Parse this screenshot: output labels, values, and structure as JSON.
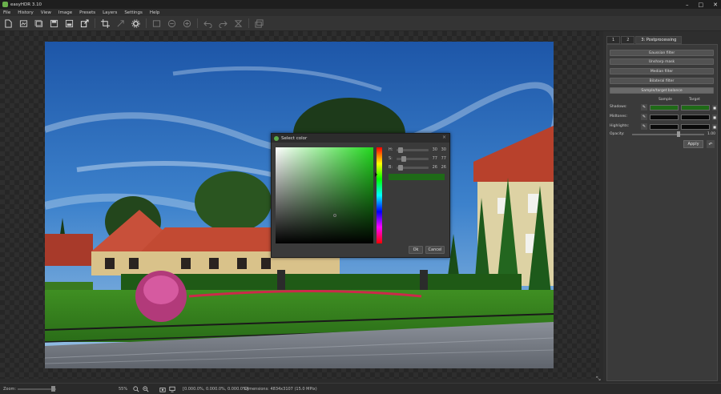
{
  "window": {
    "title": "easyHDR 3.10",
    "controls": [
      "–",
      "□",
      "✕"
    ]
  },
  "menu": [
    "File",
    "History",
    "View",
    "Image",
    "Presets",
    "Layers",
    "Settings",
    "Help"
  ],
  "toolbar": {
    "icons": [
      "new-icon",
      "open-icon",
      "open-multiple-icon",
      "save-icon",
      "save-as-icon",
      "export-icon",
      "crop-icon",
      "rotate-icon",
      "settings-icon",
      "batch-icon",
      "zoom-out-icon",
      "zoom-in-icon",
      "undo-icon",
      "redo-icon",
      "delete-icon",
      "layers-icon"
    ]
  },
  "color_dialog": {
    "title": "Select color",
    "close": "×",
    "rows": [
      {
        "label": "H:",
        "v1": "30",
        "v2": "30"
      },
      {
        "label": "S:",
        "v1": "77",
        "v2": "77"
      },
      {
        "label": "B:",
        "v1": "26",
        "v2": "26"
      }
    ],
    "preview_color": "#1f6a17",
    "ok": "Ok",
    "cancel": "Cancel"
  },
  "panel": {
    "tabs": [
      "1",
      "2",
      "3: Postprocessing"
    ],
    "filters": [
      "Gaussian filter",
      "Unsharp mask",
      "Median filter",
      "Bilateral filter",
      "Sample/target balance"
    ],
    "col_sample": "Sample",
    "col_target": "Target",
    "tones": [
      {
        "label": "Shadows:",
        "sample": "#1f6a17",
        "target": "#1f6a17"
      },
      {
        "label": "Midtones:",
        "sample": "#0a0a0a",
        "target": "#0a0a0a"
      },
      {
        "label": "Highlights:",
        "sample": "#0a0a0a",
        "target": "#0a0a0a"
      }
    ],
    "opacity_label": "Opacity:",
    "opacity_value": "1.00",
    "apply": "Apply"
  },
  "status": {
    "zoom_label": "Zoom:",
    "zoom_value": "55%",
    "pixel": "[0.000.0%, 0.000.0%, 0.000.0%]",
    "dimensions": "Dimensions: 4834x3107 (15.0 MPix)"
  }
}
